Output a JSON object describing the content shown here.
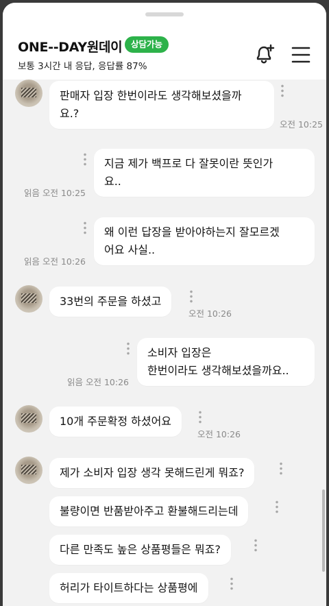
{
  "header": {
    "shop_name": "ONE--DAY원데이",
    "badge": "상담가능",
    "subtitle": "보통 3시간 내 응답, 응답률 87%",
    "accent_color": "#2db24a",
    "icons": [
      "bell-plus-icon",
      "hamburger-menu-icon"
    ]
  },
  "messages": [
    {
      "side": "in",
      "text": "판매자 입장 한번이라도 생각해보셨을까요.?",
      "time": "오전 10:25"
    },
    {
      "side": "out",
      "text": "지금 제가 백프로 다 잘못이란 뜻인가요..",
      "read": "읽음",
      "time": "오전 10:25"
    },
    {
      "side": "out",
      "text": "왜 이런 답장을 받아야하는지 잘모르겠어요 사실..",
      "read": "읽음",
      "time": "오전 10:26"
    },
    {
      "side": "in",
      "text": "33번의 주문을 하셨고",
      "time": "오전 10:26"
    },
    {
      "side": "out",
      "text": "소비자 입장은 한번이라도 생각해보셨을까요..",
      "read": "읽음",
      "time": "오전 10:26"
    },
    {
      "side": "in",
      "text": "10개 주문확정 하셨어요",
      "time": "오전 10:26"
    },
    {
      "side": "in",
      "text": "제가 소비자 입장 생각 못해드린게 뭐죠?"
    },
    {
      "side": "in",
      "text": "불량이면 반품받아주고 환불해드리는데"
    },
    {
      "side": "in",
      "text": "다른 만족도 높은 상품평들은 뭐죠?"
    },
    {
      "side": "in",
      "text": "허리가 타이트하다는 상품평에"
    }
  ],
  "lines": {
    "m0": [
      "판매자 입장 한번이라도 생각해보셨을까",
      "요.?"
    ],
    "m1": [
      "지금 제가 백프로 다 잘못이란 뜻인가",
      "요.."
    ],
    "m2": [
      "왜 이런 답장을 받아야하는지 잘모르겠",
      "어요 사실.."
    ],
    "m4": [
      "소비자 입장은",
      "한번이라도 생각해보셨을까요.."
    ]
  }
}
